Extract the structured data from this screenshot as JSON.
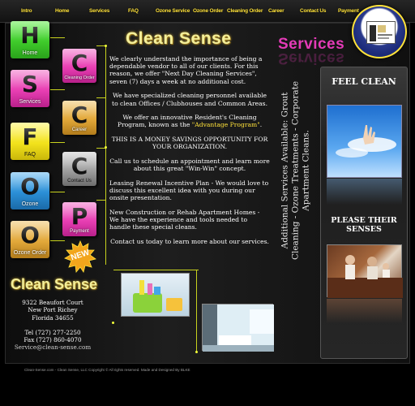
{
  "nav": [
    "Intro",
    "Home",
    "Services",
    "FAQ",
    "Ozone Service",
    "Ozone Order",
    "Cleaning Order",
    "Career",
    "Contact Us",
    "Payment"
  ],
  "tiles": {
    "home": {
      "letter": "H",
      "label": "Home"
    },
    "services": {
      "letter": "S",
      "label": "Services"
    },
    "faq": {
      "letter": "F",
      "label": "FAQ"
    },
    "ozone": {
      "letter": "O",
      "label": "Ozone"
    },
    "ozone_order": {
      "letter": "O",
      "label": "Ozone Order"
    },
    "cleaning_order": {
      "letter": "C",
      "label": "Cleaning Order"
    },
    "career": {
      "letter": "C",
      "label": "Career"
    },
    "contact": {
      "letter": "C",
      "label": "Contact Us"
    },
    "payment": {
      "letter": "P",
      "label": "Payment"
    }
  },
  "colors": {
    "green": "#3fcb2b",
    "magenta": "#e83fb3",
    "yellow": "#f2e21c",
    "blue": "#2b8fd6",
    "gold": "#e2a83a",
    "accent": "#ffe23a"
  },
  "logo_text": "Clean Sense",
  "new_badge": "NEW",
  "services_heading": "Services",
  "content": {
    "p1": "We clearly understand the importance of being a dependable vendor to all of our clients. For this reason, we offer \"Next Day Cleaning Services\", seven (7) days a week at no additional cost.",
    "p2": "We have specialized cleaning personnel available to clean Offices / Clubhouses and Common Areas.",
    "p3_pre": "We offer an innovative Resident's Cleaning Program, known as the ",
    "p3_hl": "\"Advantage Program\"",
    "p3_post": ".",
    "p4": "THIS IS A MONEY SAVINGS OPPORTUNITY FOR YOUR ORGANIZATION.",
    "p5": "Call us to schedule an appointment and learn more about this great \"Win-Win\" concept.",
    "p6": "Leasing Renewal Incentive Plan - We would love to discuss this excellent idea with you during our onsite presentation.",
    "p7": "New Construction or Rehab Apartment Homes - We have the experience and tools needed to handle these special cleans.",
    "p8": "Contact us today to learn more about our services."
  },
  "vertical_text": "Additional Services Available: Grout Cleaning - Ozone Treatments - Corporate Apartment Cleans.",
  "right_panel": {
    "feel_clean": "FEEL CLEAN",
    "please_senses": "PLEASE THEIR SENSES"
  },
  "address": {
    "street": "9322 Beaufort Court",
    "city": "New Port Richey",
    "state_zip": "Florida 34655",
    "tel": "Tel (727) 277-2250",
    "fax": "Fax (727) 860-4070",
    "email": "Service@clean-sense.com"
  },
  "footer": "Clean-Sense.com - Clean Sense, LLC Copyright © All rights reserved. Made and Designed By BLKE"
}
